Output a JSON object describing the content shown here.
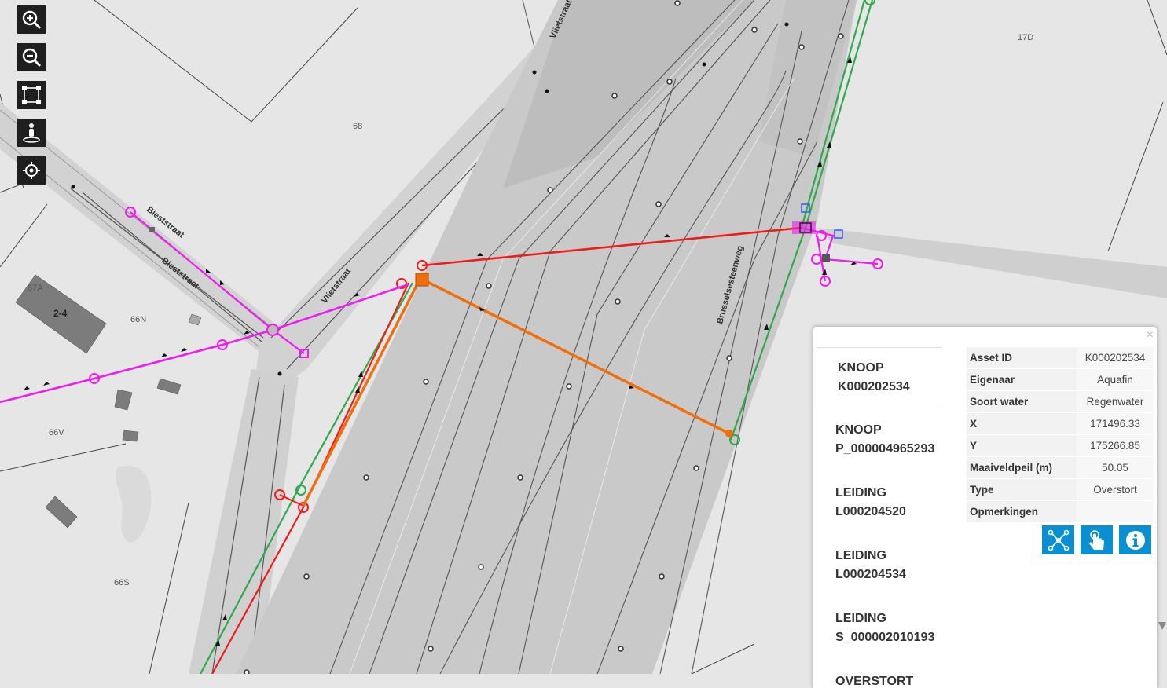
{
  "map": {
    "street_labels": {
      "bieststraat_1": "Bieststraat",
      "bieststraat_2": "Bieststraat",
      "vlietstraat_1": "Vlietstraat",
      "vlietstraat_2": "Vlietstraat",
      "brusselsesteenweg": "Brusselsesteenweg"
    },
    "parcel_labels": {
      "p68": "68",
      "p17d": "17D",
      "p67a": "67A",
      "b24": "2-4",
      "p66n": "66N",
      "p66v": "66V",
      "p66s": "66S"
    },
    "colors": {
      "background": "#e6e6e6",
      "road": "#cfcfcf",
      "road_dark": "#bcbcbc",
      "stormwater": "#ee1c1c",
      "combined": "#ee6f0c",
      "wastewater": "#ee1cee",
      "green": "#2faa4a"
    }
  },
  "toolbar": {
    "zoom_in": "zoom-in-icon",
    "zoom_out": "zoom-out-icon",
    "extent": "full-extent-icon",
    "streetview": "street-view-icon",
    "locate": "locate-icon"
  },
  "panel": {
    "close": "×",
    "features": [
      {
        "type": "KNOOP",
        "id": "K000202534"
      },
      {
        "type": "KNOOP",
        "id": "P_000004965293"
      },
      {
        "type": "LEIDING",
        "id": "L000204520"
      },
      {
        "type": "LEIDING",
        "id": "L000204534"
      },
      {
        "type": "LEIDING",
        "id": "S_000002010193"
      },
      {
        "type": "OVERSTORT",
        "id": ""
      }
    ],
    "attributes": [
      {
        "key": "Asset ID",
        "value": "K000202534"
      },
      {
        "key": "Eigenaar",
        "value": "Aquafin"
      },
      {
        "key": "Soort water",
        "value": "Regenwater"
      },
      {
        "key": "X",
        "value": "171496.33"
      },
      {
        "key": "Y",
        "value": "175266.85"
      },
      {
        "key": "Maaiveldpeil (m)",
        "value": "50.05"
      },
      {
        "key": "Type",
        "value": "Overstort"
      },
      {
        "key": "Opmerkingen",
        "value": ""
      }
    ],
    "actions": {
      "network": "network-trace-icon",
      "select": "pointer-select-icon",
      "info": "info-icon"
    },
    "accent_color": "#0a8fd2"
  }
}
